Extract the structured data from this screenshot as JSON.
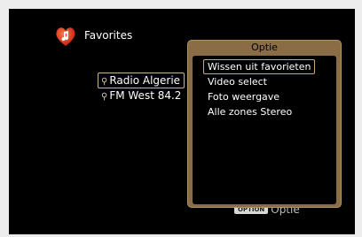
{
  "header": {
    "title": "Favorites",
    "icon": "heart-music-icon"
  },
  "favorites": [
    {
      "label": "Radio Algerie",
      "icon": "antenna-icon",
      "selected": true
    },
    {
      "label": "FM West 84.2",
      "icon": "antenna-icon",
      "selected": false
    }
  ],
  "bottom_hint": {
    "key_label": "OPTION",
    "label": "Optie"
  },
  "popup": {
    "title": "Optie",
    "items": [
      {
        "label": "Wissen uit favorieten",
        "selected": true
      },
      {
        "label": "Video select",
        "selected": false
      },
      {
        "label": "Foto weergave",
        "selected": false
      },
      {
        "label": "Alle zones Stereo",
        "selected": false
      }
    ]
  },
  "colors": {
    "screen_background": "#000000",
    "popup_frame": "#8a6c45",
    "selection_border": "#c9a978",
    "text": "#ffffff"
  }
}
